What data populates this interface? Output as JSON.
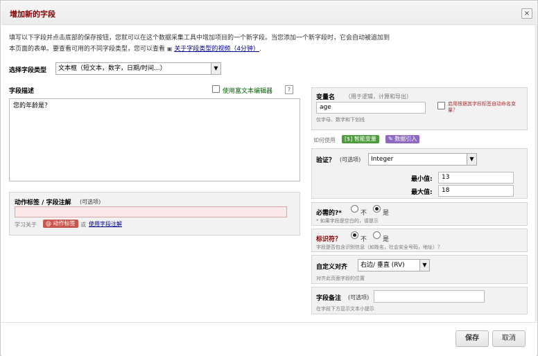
{
  "dialog": {
    "title": "增加新的字段",
    "close": "×"
  },
  "intro": {
    "line1": "填写以下字段并点击底部的保存按钮，您就可以在这个数据采集工具中增加项目的一个新字段。当您添加一个新字段时，它会自动被追加到",
    "line2_prefix": "本页面的表单。要查看可用的不同字段类型，您可以查看",
    "video_icon": "▣",
    "video_link": "关于字段类型的视频（4分钟）",
    "line2_suffix": "."
  },
  "field_type": {
    "label": "选择字段类型",
    "selected": "文本框（短文本，数字，日期/时间...）"
  },
  "field_desc": {
    "label": "字段描述",
    "rich_text_label": "使用富文本编辑器",
    "help": "?",
    "value": "您的年龄是？"
  },
  "action_tags": {
    "label": "动作标签 / 字段注解",
    "optional": "(可选项)",
    "value": "",
    "learn_prefix": "学习关于",
    "tag_button": "@ 动作标签",
    "or": "或",
    "field_note_link": "使用字段注解"
  },
  "variable": {
    "label": "变量名",
    "hint": "（用于逻辑，计算和导出）",
    "value": "age",
    "sub": "仅字母、数字和下划线",
    "auto_name": "启用根据其字段标签自动命名变量？"
  },
  "how_to": {
    "label": "如何使用",
    "smart_vars": "智能变量",
    "piping": "数据引入",
    "smart_vars_icon": "[$]",
    "piping_icon": "✎"
  },
  "validation": {
    "label": "验证？",
    "optional": "(可选项)",
    "selected": "Integer",
    "min_label": "最小值:",
    "min_value": "13",
    "max_label": "最大值:",
    "max_value": "18"
  },
  "required": {
    "label": "必需的?*",
    "no": "不",
    "yes": "是",
    "value": "yes",
    "note": "* 如果字段是空白的，请提示"
  },
  "identifier": {
    "label": "标识符？",
    "no": "不",
    "yes": "是",
    "value": "no",
    "note": "字段是否包含识别信息（如姓名，社会安全号码，地址）？"
  },
  "alignment": {
    "label": "自定义对齐",
    "selected": "右边/ 垂直 (RV)",
    "note": "对齐此页面字段的位置"
  },
  "field_note": {
    "label": "字段备注",
    "optional": "(可选项)",
    "value": "",
    "note": "在字段下方显示文本小提示"
  },
  "footer": {
    "save": "保存",
    "cancel": "取消"
  },
  "colors": {
    "title": "#800000",
    "tag_red": "#c9574f",
    "tag_green": "#4e9a3e",
    "tag_purple": "#8e6bc0"
  }
}
